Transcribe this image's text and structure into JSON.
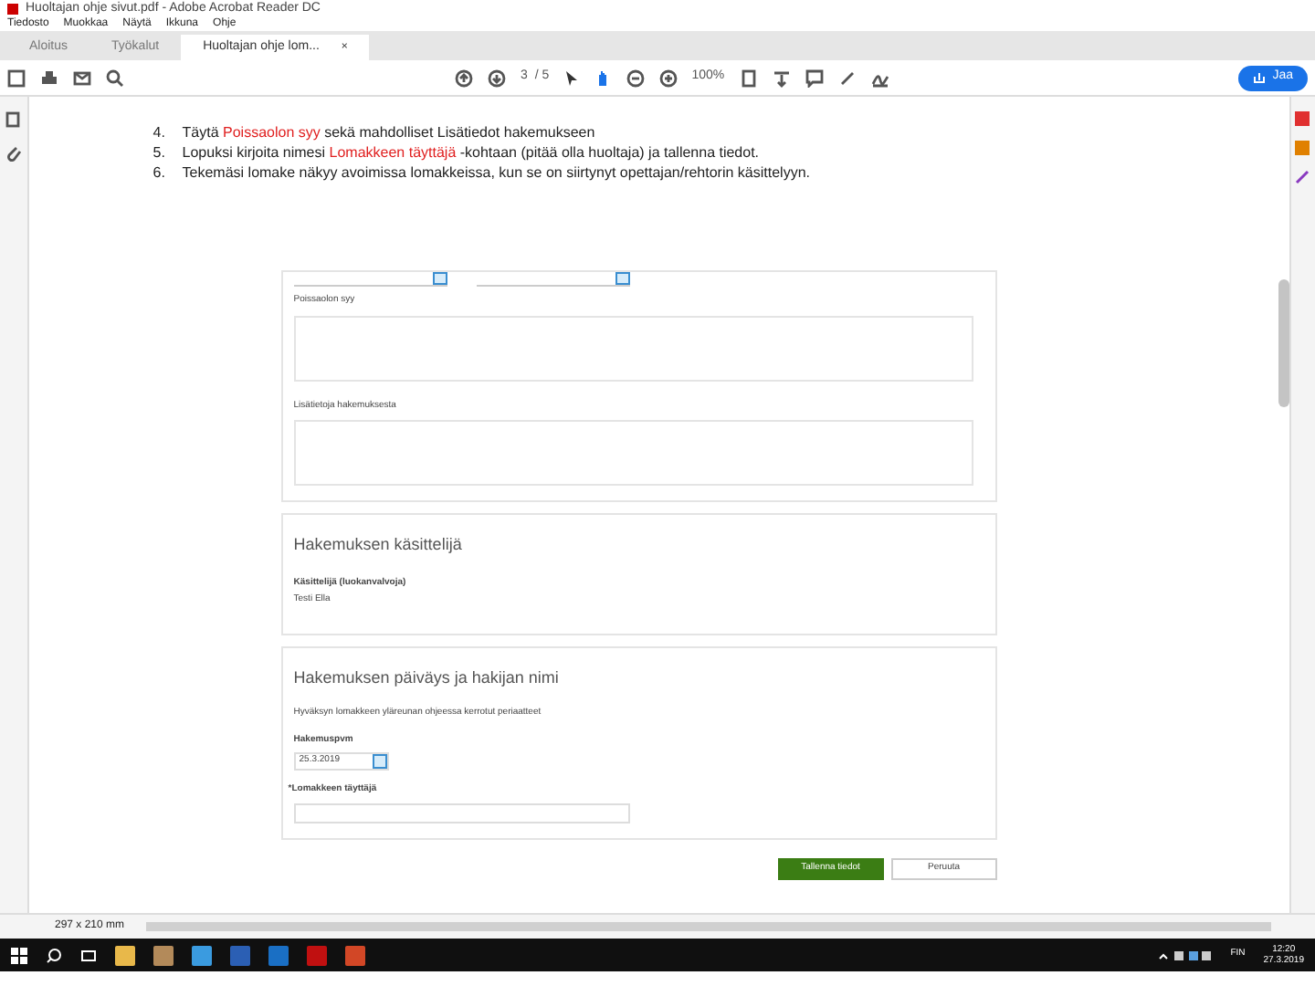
{
  "window": {
    "title": "Huoltajan ohje sivut.pdf - Adobe Acrobat Reader DC"
  },
  "menu": [
    "Tiedosto",
    "Muokkaa",
    "Näytä",
    "Ikkuna",
    "Ohje"
  ],
  "tabs": [
    {
      "label": "Aloitus",
      "selected": false
    },
    {
      "label": "Työkalut",
      "selected": false
    },
    {
      "label": "Huoltajan ohje lom...",
      "selected": true,
      "close": "×"
    }
  ],
  "toolbar": {
    "page": "3",
    "page_total": "/ 5",
    "zoom": "100%",
    "share": "Jaa"
  },
  "instructions": [
    {
      "number": "4.",
      "parts": [
        {
          "text": "Täytä ",
          "highlight": false
        },
        {
          "text": "Poissaolon syy",
          "highlight": true
        },
        {
          "text": " sekä mahdolliset Lisätiedot hakemukseen",
          "highlight": false
        }
      ]
    },
    {
      "number": "5.",
      "parts": [
        {
          "text": "Lopuksi kirjoita nimesi ",
          "highlight": false
        },
        {
          "text": "Lomakkeen täyttäjä",
          "highlight": true
        },
        {
          "text": " -kohtaan (pitää olla huoltaja) ja tallenna tiedot.",
          "highlight": false
        }
      ]
    },
    {
      "number": "6.",
      "parts": [
        {
          "text": "Tekemäsi lomake näkyy avoimissa lomakkeissa, kun se on siirtynyt opettajan/rehtorin käsittelyyn.",
          "highlight": false
        }
      ]
    }
  ],
  "form": {
    "reason_label": "Poissaolon syy",
    "extra_label": "Lisätietoja hakemuksesta",
    "handler": {
      "title": "Hakemuksen käsittelijä",
      "label": "Käsittelijä (luokanvalvoja)",
      "value": "Testi Ella"
    },
    "signature": {
      "title": "Hakemuksen päiväys ja hakijan nimi",
      "note": "Hyväksyn lomakkeen yläreunan ohjeessa kerrotut periaatteet",
      "date_label": "Hakemuspvm",
      "date_value": "25.3.2019",
      "filler_label": "*Lomakkeen täyttäjä"
    },
    "buttons": [
      {
        "label": "Tallenna tiedot",
        "kind": "primary"
      },
      {
        "label": "Peruuta",
        "kind": "secondary"
      }
    ]
  },
  "status_bar": {
    "page_size": "297 x 210 mm"
  },
  "taskbar": {
    "language": "FIN",
    "time": "12:20",
    "date": "27.3.2019"
  }
}
